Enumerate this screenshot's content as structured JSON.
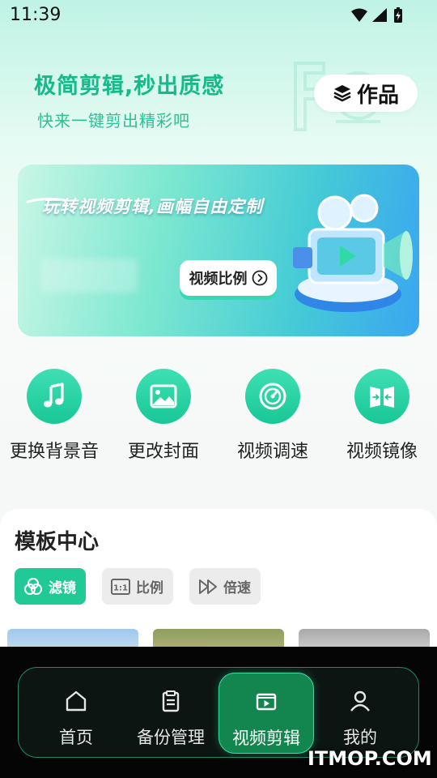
{
  "status_bar": {
    "time": "11:39",
    "icons": [
      "wifi-icon",
      "signal-icon",
      "battery-icon"
    ]
  },
  "header": {
    "headline": "极简剪辑,秒出质感",
    "subline": "快来一键剪出精彩吧",
    "works_button": {
      "label": "作品",
      "icon": "layers-icon"
    }
  },
  "banner": {
    "title": "玩转视频剪辑,画幅自由定制",
    "button_label": "视频比例",
    "button_icon": "chevron-right-circle-icon"
  },
  "tools": [
    {
      "label": "更换背景音",
      "icon": "music-note-icon"
    },
    {
      "label": "更改封面",
      "icon": "image-icon"
    },
    {
      "label": "视频调速",
      "icon": "speedometer-icon"
    },
    {
      "label": "视频镜像",
      "icon": "mirror-icon"
    }
  ],
  "template_center": {
    "title": "模板中心",
    "chips": [
      {
        "label": "滤镜",
        "icon": "filter-icon",
        "active": true
      },
      {
        "label": "比例",
        "icon": "ratio-icon",
        "active": false
      },
      {
        "label": "倍速",
        "icon": "fast-forward-icon",
        "active": false
      }
    ]
  },
  "bottom_nav": {
    "items": [
      {
        "label": "首页",
        "icon": "home-icon",
        "active": false
      },
      {
        "label": "备份管理",
        "icon": "clipboard-icon",
        "active": false
      },
      {
        "label": "视频剪辑",
        "icon": "video-edit-icon",
        "active": true
      },
      {
        "label": "我的",
        "icon": "user-icon",
        "active": false
      }
    ]
  },
  "watermark": "ITMOP.COM",
  "colors": {
    "accent": "#20c996",
    "headline": "#16b98a",
    "nav_active": "#13854f"
  }
}
